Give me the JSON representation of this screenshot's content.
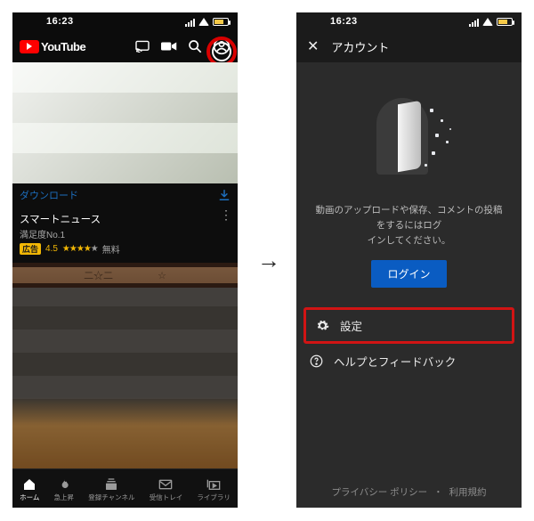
{
  "status": {
    "time": "16:23"
  },
  "left": {
    "brand": "YouTube",
    "download_label": "ダウンロード",
    "ad": {
      "title": "スマートニュース",
      "subtitle": "満足度No.1",
      "badge": "広告",
      "rating_text": "4.5",
      "free": "無料"
    },
    "decor": {
      "left": "二☆二",
      "right": "☆"
    },
    "nav": {
      "home": "ホーム",
      "trending": "急上昇",
      "subs": "登録チャンネル",
      "inbox": "受信トレイ",
      "library": "ライブラリ"
    }
  },
  "right": {
    "title": "アカウント",
    "hint": "動画のアップロードや保存、コメントの投稿をするにはログ\nインしてください。",
    "login": "ログイン",
    "settings": "設定",
    "help": "ヘルプとフィードバック",
    "privacy": "プライバシー ポリシー",
    "terms": "利用規約"
  }
}
